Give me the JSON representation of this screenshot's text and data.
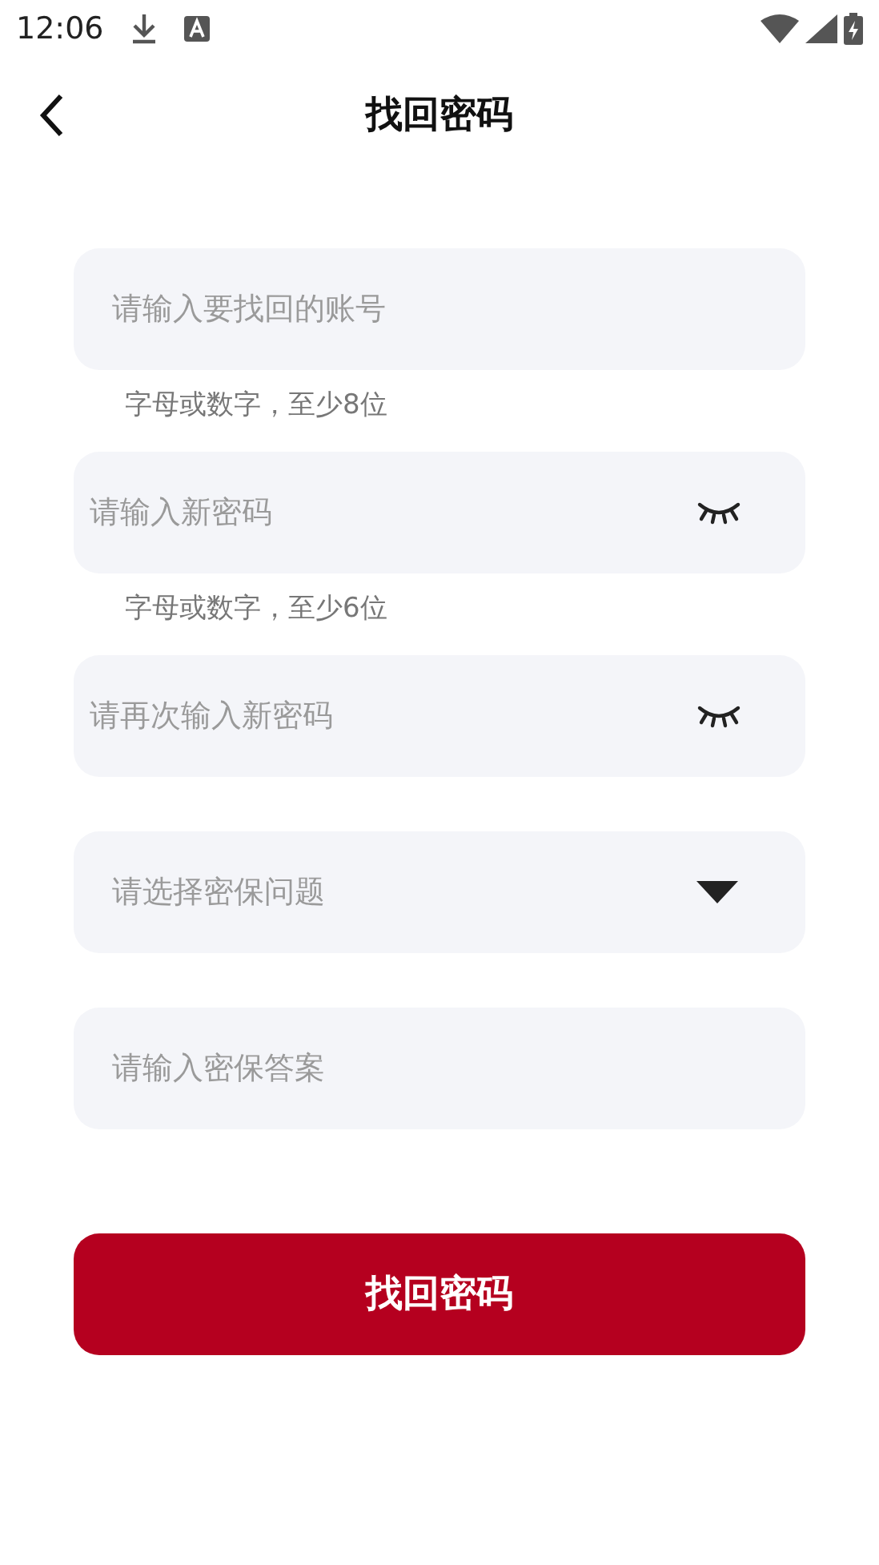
{
  "status_bar": {
    "time": "12:06"
  },
  "header": {
    "title": "找回密码"
  },
  "fields": [
    {
      "kind": "text",
      "placeholder": "请输入要找回的账号",
      "hint": "字母或数字，至少8位"
    },
    {
      "kind": "password",
      "placeholder": "请输入新密码",
      "visible": false,
      "hint": "字母或数字，至少6位"
    },
    {
      "kind": "password",
      "placeholder": "请再次输入新密码",
      "visible": false
    },
    {
      "kind": "select",
      "placeholder": "请选择密保问题"
    },
    {
      "kind": "text",
      "placeholder": "请输入密保答案"
    }
  ],
  "submit": {
    "label": "找回密码"
  }
}
